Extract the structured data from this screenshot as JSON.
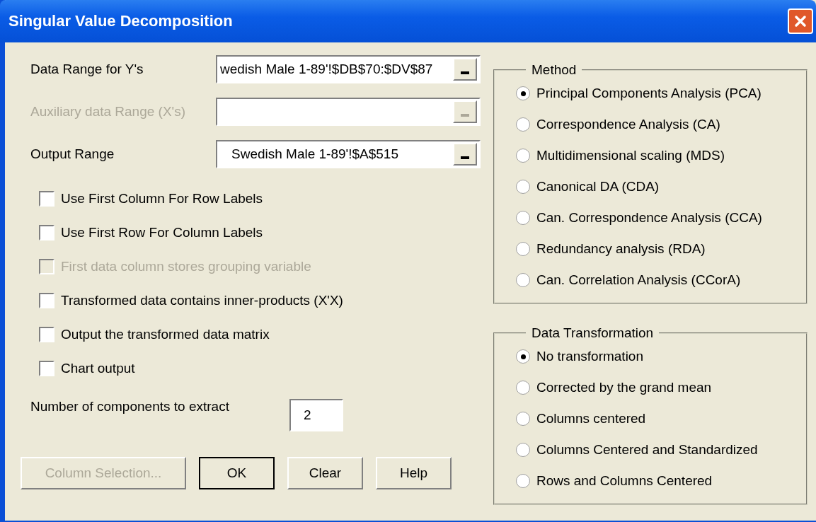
{
  "window": {
    "title": "Singular Value Decomposition"
  },
  "fields": [
    {
      "label": "Data Range for Y's",
      "value": "wedish Male 1-89'!$DB$70:$DV$87",
      "disabled": false
    },
    {
      "label": "Auxiliary data Range (X's)",
      "disabled": true
    },
    {
      "label": "Output  Range",
      "value": "Swedish Male 1-89'!$A$515",
      "disabled": false
    }
  ],
  "checkboxes": [
    {
      "label": "Use First Column For Row Labels",
      "checked": false,
      "disabled": false
    },
    {
      "label": "Use First Row  For Column  Labels",
      "checked": false,
      "disabled": false
    },
    {
      "label": "First data column stores grouping variable",
      "checked": false,
      "disabled": true
    },
    {
      "label": "Transformed data contains inner-products (X'X)",
      "checked": false,
      "disabled": false
    },
    {
      "label": "Output the transformed data matrix",
      "checked": false,
      "disabled": false
    },
    {
      "label": "Chart output",
      "checked": false,
      "disabled": false
    }
  ],
  "components": {
    "label": "Number of components to extract",
    "value": "2"
  },
  "buttons": [
    {
      "label": "Column Selection...",
      "disabled": true,
      "default": false
    },
    {
      "label": "OK",
      "disabled": false,
      "default": true
    },
    {
      "label": "Clear",
      "disabled": false,
      "default": false
    },
    {
      "label": "Help",
      "disabled": false,
      "default": false
    }
  ],
  "method": {
    "title": "Method",
    "options": [
      {
        "label": "Principal Components Analysis (PCA)",
        "selected": true
      },
      {
        "label": "Correspondence Analysis (CA)",
        "selected": false
      },
      {
        "label": "Multidimensional scaling (MDS)",
        "selected": false
      },
      {
        "label": "Canonical  DA (CDA)",
        "selected": false
      },
      {
        "label": "Can. Correspondence Analysis (CCA)",
        "selected": false
      },
      {
        "label": "Redundancy analysis (RDA)",
        "selected": false
      },
      {
        "label": "Can. Correlation Analysis (CCorA)",
        "selected": false
      }
    ]
  },
  "transformation": {
    "title": "Data Transformation",
    "options": [
      {
        "label": "No transformation",
        "selected": true
      },
      {
        "label": "Corrected by the grand mean",
        "selected": false
      },
      {
        "label": "Columns centered",
        "selected": false
      },
      {
        "label": "Columns Centered and Standardized",
        "selected": false
      },
      {
        "label": "Rows and Columns Centered",
        "selected": false
      }
    ]
  }
}
